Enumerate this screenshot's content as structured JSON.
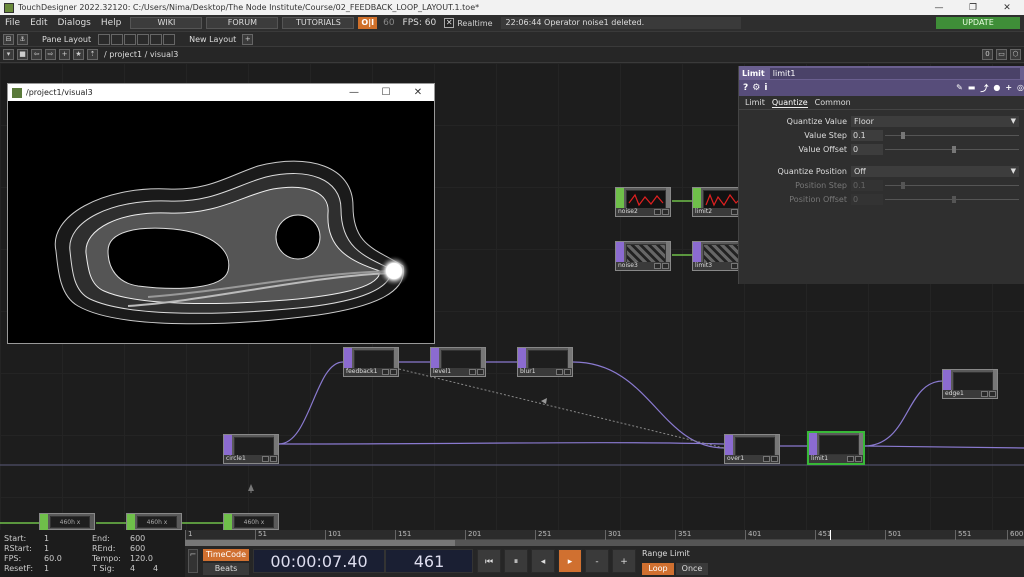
{
  "titlebar": {
    "title": "TouchDesigner 2022.32120: C:/Users/Nima/Desktop/The Node Institute/Course/02_FEEDBACK_LOOP_LAYOUT.1.toe*",
    "minimize": "—",
    "restore": "❐",
    "close": "✕"
  },
  "menubar": {
    "items": [
      "File",
      "Edit",
      "Dialogs",
      "Help"
    ],
    "wiki": "WIKI",
    "forum": "FORUM",
    "tutorials": "TUTORIALS",
    "perf": "O|I",
    "fps_target": "60",
    "fps_label": "FPS:  60",
    "realtime": "Realtime",
    "status": "22:06:44 Operator noise1 deleted.",
    "update": "UPDATE"
  },
  "panebar": {
    "pane_layout": "Pane Layout",
    "new_layout": "New Layout",
    "plus": "+"
  },
  "pathbar": {
    "path": "/ project1 / visual3",
    "count": "0"
  },
  "viewer": {
    "title": "/project1/visual3",
    "minimize": "—",
    "maximize": "☐",
    "close": "✕"
  },
  "params": {
    "op_type": "Limit",
    "op_name": "limit1",
    "tabs": [
      "Limit",
      "Quantize",
      "Common"
    ],
    "active_tab": "Quantize",
    "rows": {
      "quantize_value": {
        "label": "Quantize Value",
        "value": "Floor"
      },
      "value_step": {
        "label": "Value Step",
        "value": "0.1"
      },
      "value_offset": {
        "label": "Value Offset",
        "value": "0"
      },
      "quantize_position": {
        "label": "Quantize Position",
        "value": "Off"
      },
      "position_step": {
        "label": "Position Step",
        "value": "0.1"
      },
      "position_offset": {
        "label": "Position Offset",
        "value": "0"
      }
    }
  },
  "nodes": {
    "noise2": "noise2",
    "limit2": "limit2",
    "noise3": "noise3",
    "limit3": "limit3",
    "feedback1": "feedback1",
    "level1": "level1",
    "blur1": "blur1",
    "circle1": "circle1",
    "over1": "over1",
    "limit1": "limit1",
    "edge1": "edge1",
    "bottom_row": [
      "460h x",
      "460h x",
      "460h x"
    ]
  },
  "timeline": {
    "ticks": [
      "1",
      "51",
      "101",
      "151",
      "201",
      "251",
      "301",
      "351",
      "401",
      "451",
      "501",
      "551",
      "600"
    ],
    "info": {
      "start_label": "Start:",
      "start": "1",
      "end_label": "End:",
      "end": "600",
      "rstart_label": "RStart:",
      "rstart": "1",
      "rend_label": "REnd:",
      "rend": "600",
      "fps_label": "FPS:",
      "fps": "60.0",
      "tempo_label": "Tempo:",
      "tempo": "120.0",
      "resetf_label": "ResetF:",
      "resetf": "1",
      "tsig_label": "T Sig:",
      "tsig_a": "4",
      "tsig_b": "4"
    },
    "timecode_btn": "TimeCode",
    "beats_btn": "Beats",
    "timecode": "00:00:07.40",
    "frame": "461",
    "btn_start": "⏮",
    "btn_pause": "⏸",
    "btn_back": "◂",
    "btn_play": "▸",
    "btn_minus": "-",
    "btn_plus": "+",
    "range_limit": "Range Limit",
    "loop": "Loop",
    "once": "Once"
  }
}
